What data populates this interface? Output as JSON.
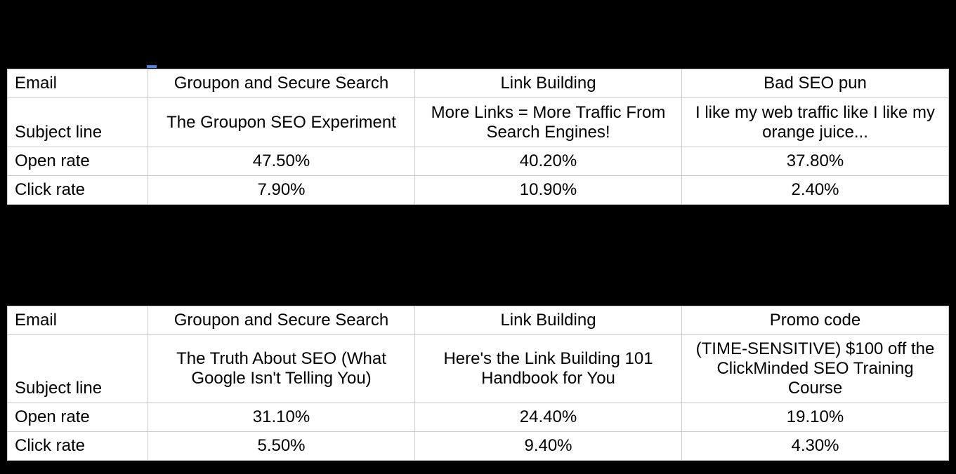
{
  "chart_data": [
    {
      "type": "table",
      "title": "",
      "row_headers": [
        "Email",
        "Subject line",
        "Open rate",
        "Click rate"
      ],
      "columns": [
        {
          "email": "Groupon and Secure Search",
          "subject_line": "The Groupon SEO Experiment",
          "open_rate": "47.50%",
          "click_rate": "7.90%"
        },
        {
          "email": "Link Building",
          "subject_line": "More Links = More Traffic From Search Engines!",
          "open_rate": "40.20%",
          "click_rate": "10.90%"
        },
        {
          "email": "Bad SEO pun",
          "subject_line": "I like my web traffic like I like my orange juice...",
          "open_rate": "37.80%",
          "click_rate": "2.40%"
        }
      ]
    },
    {
      "type": "table",
      "title": "",
      "row_headers": [
        "Email",
        "Subject line",
        "Open rate",
        "Click rate"
      ],
      "columns": [
        {
          "email": "Groupon and Secure Search",
          "subject_line": "The Truth About SEO (What Google Isn't Telling You)",
          "open_rate": "31.10%",
          "click_rate": "5.50%"
        },
        {
          "email": "Link Building",
          "subject_line": "Here's the Link Building 101 Handbook for You",
          "open_rate": "24.40%",
          "click_rate": "9.40%"
        },
        {
          "email": "Promo code",
          "subject_line": "(TIME-SENSITIVE) $100 off the ClickMinded SEO Training Course",
          "open_rate": "19.10%",
          "click_rate": "4.30%"
        }
      ]
    }
  ],
  "table1": {
    "row0_label": "Email",
    "row1_label": "Subject line",
    "row2_label": "Open rate",
    "row3_label": "Click rate",
    "c0_email": "Groupon and Secure Search",
    "c0_subject": "The Groupon SEO Experiment",
    "c0_open": "47.50%",
    "c0_click": "7.90%",
    "c1_email": "Link Building",
    "c1_subject": "More Links = More Traffic From Search Engines!",
    "c1_open": "40.20%",
    "c1_click": "10.90%",
    "c2_email": "Bad SEO pun",
    "c2_subject": "I like my web traffic like I like my orange juice...",
    "c2_open": "37.80%",
    "c2_click": "2.40%"
  },
  "table2": {
    "row0_label": "Email",
    "row1_label": "Subject line",
    "row2_label": "Open rate",
    "row3_label": "Click rate",
    "c0_email": "Groupon and Secure Search",
    "c0_subject": "The Truth About SEO (What Google Isn't Telling You)",
    "c0_open": "31.10%",
    "c0_click": "5.50%",
    "c1_email": "Link Building",
    "c1_subject": "Here's the Link Building 101 Handbook for You",
    "c1_open": "24.40%",
    "c1_click": "9.40%",
    "c2_email": "Promo code",
    "c2_subject": "(TIME-SENSITIVE) $100 off the ClickMinded SEO Training Course",
    "c2_open": "19.10%",
    "c2_click": "4.30%"
  }
}
